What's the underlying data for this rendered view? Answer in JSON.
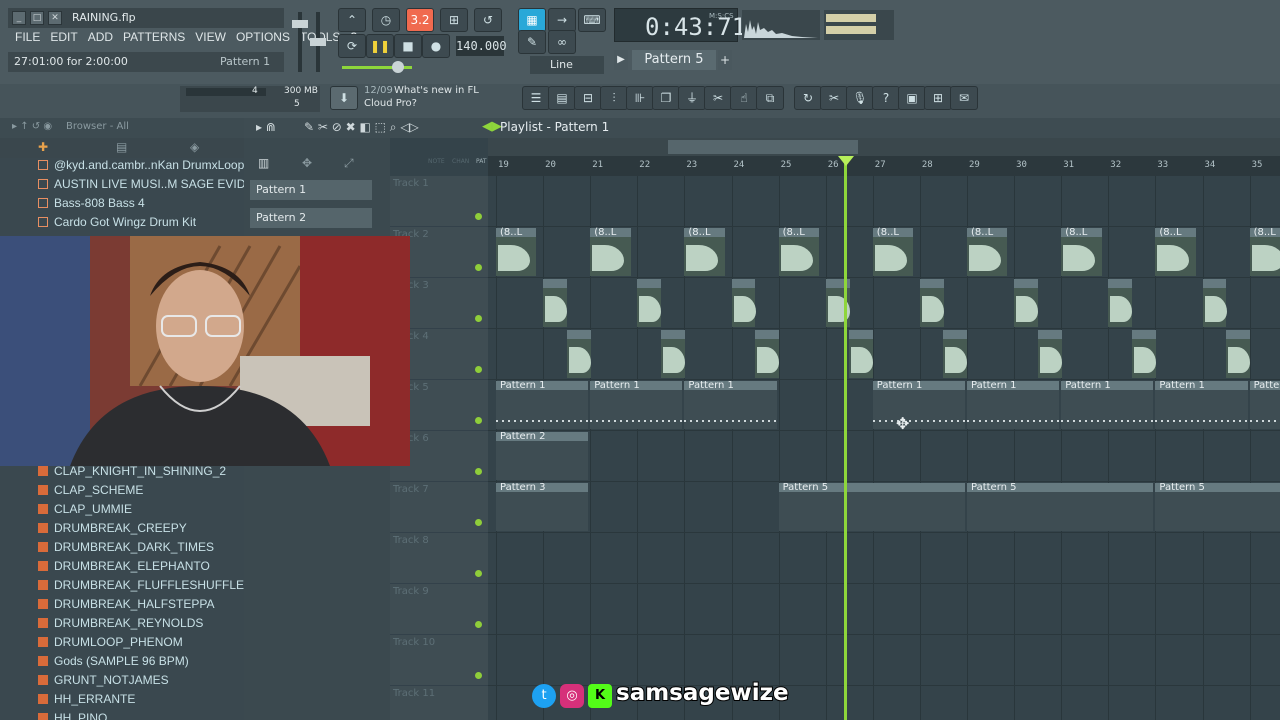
{
  "app": {
    "file_name": "RAINING.flp",
    "hint_text": "27:01:00 for 2:00:00",
    "hint_pattern": "Pattern 1",
    "menu": [
      "FILE",
      "EDIT",
      "ADD",
      "PATTERNS",
      "VIEW",
      "OPTIONS",
      "TOOLS",
      "?"
    ],
    "time_display": "0:43:71",
    "time_label": "M:S:CS",
    "tempo": "140.000",
    "pattern_selector": "Pattern 5",
    "snap_mode": "Line",
    "memory": "300 MB",
    "cpu_value": "4",
    "poly_value": "5",
    "news_date": "12/09",
    "news_text_1": "What's new in FL",
    "news_text_2": "Cloud Pro?",
    "accent_color": "#8ed63b",
    "record_color": "#f06a4f"
  },
  "browser": {
    "header": "Browser - All",
    "items_top": [
      "@kyd.and.cambr..nKan DrumxLoopKit",
      "AUSTIN LIVE MUSI..M SAGE EVIDENCE",
      "Bass-808 Bass 4",
      "Cardo Got Wingz Drum Kit"
    ],
    "items_bottom": [
      "CLAP_KNIGHT_IN_SHINING_2",
      "CLAP_SCHEME",
      "CLAP_UMMIE",
      "DRUMBREAK_CREEPY",
      "DRUMBREAK_DARK_TIMES",
      "DRUMBREAK_ELEPHANTO",
      "DRUMBREAK_FLUFFLESHUFFLE",
      "DRUMBREAK_HALFSTEPPA",
      "DRUMBREAK_REYNOLDS",
      "DRUMLOOP_PHENOM",
      "Gods (SAMPLE 96 BPM)",
      "GRUNT_NOTJAMES",
      "HH_ERRANTE",
      "HH_PINO"
    ]
  },
  "patterns": [
    "Pattern 1",
    "Pattern 2"
  ],
  "playlist": {
    "title": "Playlist - Pattern 1",
    "ruler": [
      "19",
      "20",
      "21",
      "22",
      "23",
      "24",
      "25",
      "26",
      "27",
      "28",
      "29",
      "30",
      "31",
      "32",
      "33",
      "34",
      "35"
    ],
    "tracks": [
      "Track 1",
      "Track 2",
      "Track 3",
      "Track 4",
      "Track 5",
      "Track 6",
      "Track 7",
      "Track 8",
      "Track 9",
      "Track 10",
      "Track 11"
    ],
    "clip_audio_label": "(8..L",
    "clip_pattern1": "Pattern 1",
    "clip_pattern2": "Pattern 2",
    "clip_pattern3": "Pattern 3",
    "clip_pattern5": "Pattern 5",
    "header_cols": [
      "NOTE",
      "CHAN",
      "PAT"
    ]
  },
  "overlay": {
    "handle": "samsagewize"
  }
}
